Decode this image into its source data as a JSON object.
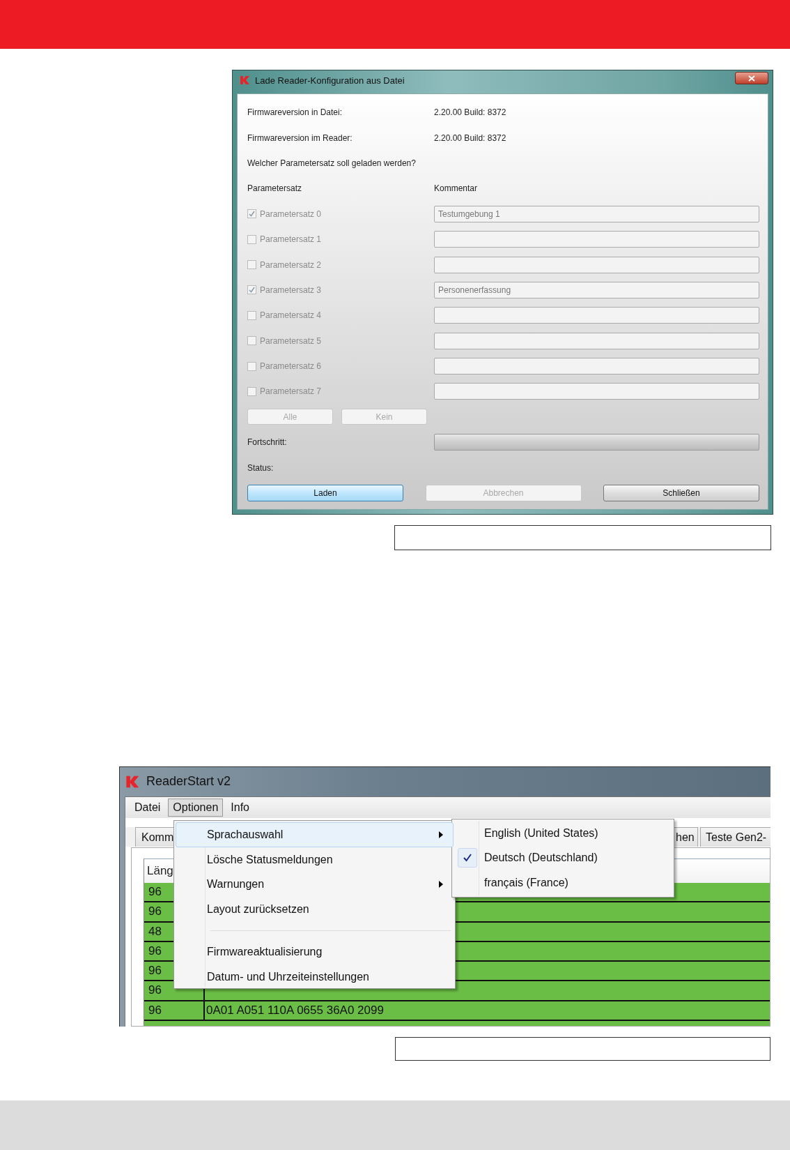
{
  "load_dialog": {
    "title": "Lade Reader-Konfiguration aus Datei",
    "info_rows": [
      {
        "label": "Firmwareversion in Datei:",
        "value": "2.20.00 Build: 8372"
      },
      {
        "label": "Firmwareversion im Reader:",
        "value": "2.20.00 Build: 8372"
      }
    ],
    "question": "Welcher Parametersatz soll geladen werden?",
    "columns": [
      "Parametersatz",
      "Kommentar"
    ],
    "parameter_sets": [
      {
        "label": "Parametersatz 0",
        "checked": true,
        "disabled": true,
        "comment": "Testumgebung 1"
      },
      {
        "label": "Parametersatz 1",
        "checked": false,
        "disabled": true
      },
      {
        "label": "Parametersatz 2",
        "checked": false,
        "disabled": true
      },
      {
        "label": "Parametersatz 3",
        "checked": true,
        "disabled": true,
        "comment": "Personenerfassung"
      },
      {
        "label": "Parametersatz 4",
        "checked": false,
        "disabled": true
      },
      {
        "label": "Parametersatz 5",
        "checked": false,
        "disabled": true
      },
      {
        "label": "Parametersatz 6",
        "checked": false,
        "disabled": true
      },
      {
        "label": "Parametersatz 7",
        "checked": false,
        "disabled": true
      }
    ],
    "select_buttons": [
      {
        "label": "Alle",
        "disabled": true
      },
      {
        "label": "Kein",
        "disabled": true
      }
    ],
    "progress": {
      "label": "Fortschritt:",
      "level": 0
    },
    "status": {
      "label": "Status:"
    },
    "buttons": [
      {
        "label": "Laden",
        "disabled": false,
        "default": true
      },
      {
        "label": "Abbrechen",
        "disabled": true,
        "default": false
      },
      {
        "label": "Schließen",
        "disabled": false,
        "default": false
      }
    ]
  },
  "reader_window": {
    "title": "ReaderStart v2",
    "menu": [
      {
        "label": "Datei",
        "selected": false
      },
      {
        "label": "Optionen",
        "selected": true
      },
      {
        "label": "Info",
        "selected": false
      }
    ],
    "tabs": [
      {
        "label": "Komm"
      },
      {
        "label": "hen"
      },
      {
        "label": "Teste Gen2-"
      }
    ],
    "table": {
      "columns": [
        "Läng"
      ],
      "rows": [
        {
          "cells": [
            "96"
          ]
        },
        {
          "cells": [
            "96"
          ]
        },
        {
          "cells": [
            "48"
          ]
        },
        {
          "cells": [
            "96"
          ]
        },
        {
          "cells": [
            "96"
          ]
        },
        {
          "cells": [
            "96"
          ]
        },
        {
          "cells": [
            "96",
            "0A01 A051 110A 0655 36A0 2099"
          ]
        }
      ]
    },
    "options_menu": [
      {
        "kind": "submenu",
        "label": "Sprachauswahl",
        "selected": true
      },
      {
        "kind": "item",
        "label": "Lösche Statusmeldungen",
        "selected": false
      },
      {
        "kind": "submenu",
        "label": "Warnungen",
        "selected": false
      },
      {
        "kind": "item",
        "label": "Layout zurücksetzen",
        "selected": false
      },
      {
        "kind": "separator"
      },
      {
        "kind": "item",
        "label": "Firmwareaktualisierung",
        "selected": false
      },
      {
        "kind": "item",
        "label": "Datum- und Uhrzeiteinstellungen",
        "selected": false
      }
    ],
    "language_menu": [
      {
        "label": "English (United States)",
        "checked": false
      },
      {
        "label": "Deutsch (Deutschland)",
        "checked": true
      },
      {
        "label": "français (France)",
        "checked": false
      }
    ]
  }
}
